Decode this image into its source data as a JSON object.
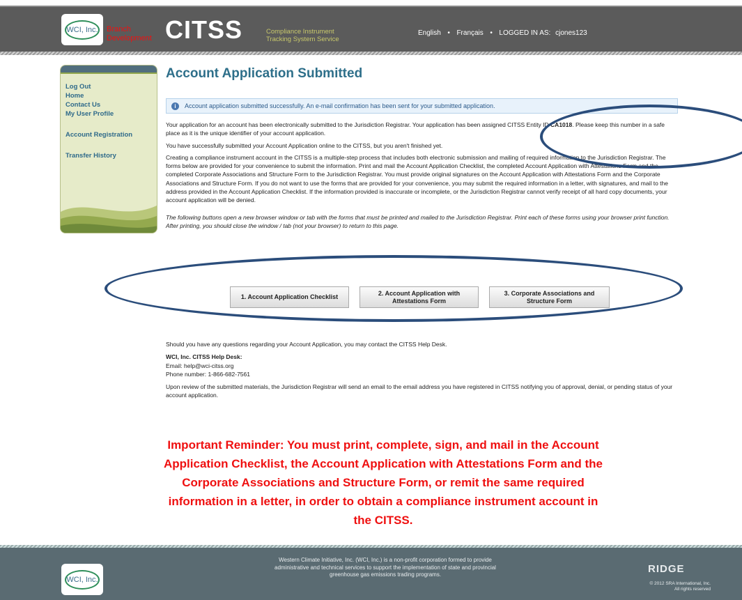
{
  "header": {
    "logo_text": "WCI, Inc.",
    "branch_label": "Branch Development",
    "app_name": "CITSS",
    "app_subtitle_line1": "Compliance Instrument",
    "app_subtitle_line2": "Tracking System Service",
    "lang_english": "English",
    "lang_french": "Français",
    "logged_in_label": "LOGGED IN AS:",
    "username": "cjones123"
  },
  "sidebar": {
    "items": [
      {
        "label": "Log Out"
      },
      {
        "label": "Home"
      },
      {
        "label": "Contact Us"
      },
      {
        "label": "My User Profile"
      },
      {
        "label": "Account Registration"
      },
      {
        "label": "Transfer History"
      }
    ]
  },
  "main": {
    "title": "Account Application Submitted",
    "alert": "Account application submitted successfully. An e-mail confirmation has been sent for your submitted application.",
    "p1_prefix": "Your application for an account has been electronically submitted to the Jurisdiction Registrar. Your application has been assigned CITSS Entity ID ",
    "entity_id": "CA1018",
    "p1_suffix": ". Please keep this number in a safe place as it is the unique identifier of your account application.",
    "p2": "You have successfully submitted your Account Application online to the CITSS, but you aren't finished yet.",
    "p3": "Creating a compliance instrument account in the CITSS is a multiple-step process that includes both electronic submission and mailing of required information to the Jurisdiction Registrar. The forms below are provided for your convenience to submit the information. Print and mail the Account Application Checklist, the completed Account Application with Attestations Form and the completed Corporate Associations and Structure Form to the Jurisdiction Registrar. You must provide original signatures on the Account Application with Attestations Form and the Corporate Associations and Structure Form. If you do not want to use the forms that are provided for your convenience, you may submit the required information in a letter, with signatures, and mail to the address provided in the Account Application Checklist. If the information provided is inaccurate or incomplete, or the Jurisdiction Registrar cannot verify receipt of all hard copy documents, your account application will be denied.",
    "p4": "The following buttons open a new browser window or tab with the forms that must be printed and mailed to the Jurisdiction Registrar. Print each of these forms using your browser print function. After printing, you should close the window / tab (not your browser) to return to this page.",
    "buttons": [
      {
        "label": "1. Account Application Checklist"
      },
      {
        "label": "2. Account Application with Attestations Form"
      },
      {
        "label": "3. Corporate Associations and Structure Form"
      }
    ],
    "questions": "Should you have any questions regarding your Account Application, you may contact the CITSS Help Desk.",
    "helpdesk_title": "WCI, Inc. CITSS Help Desk:",
    "helpdesk_email": "Email: help@wci-citss.org",
    "helpdesk_phone": "Phone number: 1-866-682-7561",
    "review_text": "Upon review of the submitted materials, the Jurisdiction Registrar will send an email to the email address you have registered in CITSS notifying you of approval, denial, or pending status of your account application.",
    "reminder": "Important Reminder: You must print, complete, sign, and mail in the Account Application Checklist, the Account Application with Attestations Form and the Corporate Associations and Structure Form, or remit the same required information in a letter, in order to obtain a compliance instrument account in the CITSS."
  },
  "footer": {
    "logo_text": "WCI, Inc.",
    "description": "Western Climate Initiative, Inc. (WCI, Inc.) is a non-profit corporation formed to provide administrative and technical services to support the implementation of state and provincial greenhouse gas emissions trading programs.",
    "ridge": "RIDGE",
    "copyright_line1": "© 2012 SRA International, Inc.",
    "copyright_line2": "All rights reserved"
  },
  "colors": {
    "header_bg": "#5b5b5b",
    "title_blue": "#2e6f8a",
    "reminder_red": "#ef1010",
    "annotation_oval": "#2b4d7b"
  }
}
